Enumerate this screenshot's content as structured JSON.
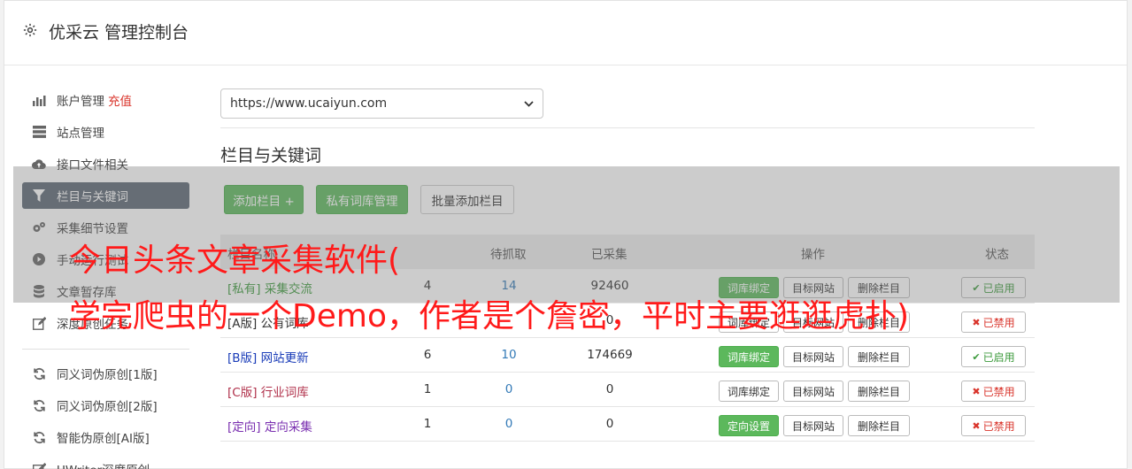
{
  "header": {
    "title": "优采云 管理控制台"
  },
  "sidebar": {
    "items": [
      {
        "label": "账户管理",
        "extra": "充值",
        "icon": "bar-chart-icon"
      },
      {
        "label": "站点管理",
        "icon": "server-icon"
      },
      {
        "label": "接口文件相关",
        "icon": "cloud-upload-icon"
      },
      {
        "label": "栏目与关键词",
        "icon": "filter-icon",
        "active": true
      },
      {
        "label": "采集细节设置",
        "icon": "cogs-icon"
      },
      {
        "label": "手动运行测试",
        "icon": "play-icon"
      },
      {
        "label": "文章暂存库",
        "icon": "database-icon"
      },
      {
        "label": "深度原创任务",
        "icon": "edit-icon"
      },
      {
        "label": "同义词伪原创[1版]",
        "icon": "refresh-icon"
      },
      {
        "label": "同义词伪原创[2版]",
        "icon": "refresh-icon"
      },
      {
        "label": "智能伪原创[AI版]",
        "icon": "refresh-icon"
      },
      {
        "label": "UWriter深度原创",
        "icon": "edit-icon"
      }
    ]
  },
  "main": {
    "site_select": "https://www.ucaiyun.com",
    "section_title": "栏目与关键词",
    "buttons": {
      "add_column": "添加栏目 +",
      "private_lib": "私有词库管理",
      "batch_add": "批量添加栏目"
    },
    "table": {
      "headers": [
        "栏目名称",
        "待抓取",
        "已采集",
        "操作",
        "状态"
      ],
      "rows": [
        {
          "tag": "[私有]",
          "name": "采集交流",
          "n1": "4",
          "n2": "14",
          "n3": "92460",
          "op1": "词库绑定",
          "op2": "目标网站",
          "op3": "删除栏目",
          "status": "已启用",
          "enabled": true,
          "tag_color": "#3c9a3c"
        },
        {
          "tag": "[A版]",
          "name": "公有词库",
          "n1": "",
          "n2": "",
          "n3": "0",
          "op1": "词库绑定",
          "op2": "目标网站",
          "op3": "删除栏目",
          "status": "已禁用",
          "enabled": false,
          "tag_color": "#333333"
        },
        {
          "tag": "[B版]",
          "name": "网站更新",
          "n1": "6",
          "n2": "10",
          "n3": "174669",
          "op1": "词库绑定",
          "op2": "目标网站",
          "op3": "删除栏目",
          "status": "已启用",
          "enabled": true,
          "tag_color": "#1a3cb8"
        },
        {
          "tag": "[C版]",
          "name": "行业词库",
          "n1": "1",
          "n2": "0",
          "n3": "0",
          "op1": "词库绑定",
          "op2": "目标网站",
          "op3": "删除栏目",
          "status": "已禁用",
          "enabled": false,
          "tag_color": "#b0304a"
        },
        {
          "tag": "[定向]",
          "name": "定向采集",
          "n1": "1",
          "n2": "0",
          "n3": "0",
          "op1": "定向设置",
          "op2": "目标网站",
          "op3": "删除栏目",
          "status": "已禁用",
          "enabled": false,
          "tag_color": "#7a2fb0"
        }
      ]
    }
  },
  "overlay": {
    "line1": "今日头条文章采集软件(",
    "line2": "学完爬虫的一个Demo，作者是个詹密，平时主要逛逛虎扑)"
  },
  "colors": {
    "accent_green": "#5cb85c",
    "active_nav": "#5b6673",
    "caption_red": "#ff1a1a",
    "recharge_red": "#d9342b",
    "link_blue": "#337ab7"
  }
}
